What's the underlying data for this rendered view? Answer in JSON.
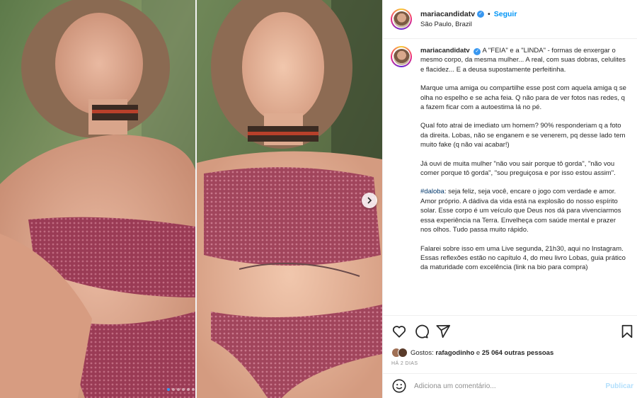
{
  "post": {
    "username": "mariacandidatv",
    "follow_label": "Seguir",
    "separator": "•",
    "location": "São Paulo, Brazil",
    "more": "···"
  },
  "caption": {
    "username": "mariacandidatv",
    "paragraph1": "A \"FEIA\" e a \"LINDA\" - formas de enxergar o mesmo corpo, da mesma mulher... A real, com suas dobras, celulites e flacidez... E a deusa supostamente perfeitinha.",
    "paragraph2": "Marque uma amiga ou compartilhe esse post com aquela amiga q se olha no espelho e se acha feia. Q não para de ver fotos nas redes, q a fazem ficar com a autoestima lá no pé.",
    "paragraph3": "Qual foto atrai de imediato um homem? 90% responderiam q a foto da direita. Lobas, não se enganem e se venerem, pq desse lado tem muito fake (q não vai acabar!)",
    "paragraph4": "Já ouvi de muita mulher \"não vou sair porque tô gorda\", \"não vou comer porque tô gorda\", \"sou preguiçosa e por isso estou assim\".",
    "hashtag": "#daloba",
    "paragraph5": ": seja feliz, seja você, encare o jogo com verdade e amor. Amor próprio. A dádiva da vida está na explosão do nosso espírito solar. Esse corpo é um veículo que Deus nos dá para vivenciarmos essa experiência na Terra. Envelheça com saúde mental e prazer nos olhos. Tudo passa muito rápido.",
    "paragraph6": "Falarei sobre isso em uma Live segunda, 21h30, aqui no Instagram. Essas reflexões estão no capítulo 4, do meu livro Lobas, guia prático da maturidade com excelência (link na bio para compra)"
  },
  "likes": {
    "prefix": "Gostos:",
    "user": "rafagodinho",
    "connector": "e",
    "others": "25 064 outras pessoas"
  },
  "timestamp": "HÁ 2 DIAS",
  "comment": {
    "placeholder": "Adiciona um comentário...",
    "publish_label": "Publicar"
  },
  "carousel": {
    "total": 6,
    "active_index": 0
  },
  "colors": {
    "link": "#0095f6",
    "hashtag": "#00376b",
    "muted": "#8e8e8e",
    "active_dot": "#3797f0"
  }
}
